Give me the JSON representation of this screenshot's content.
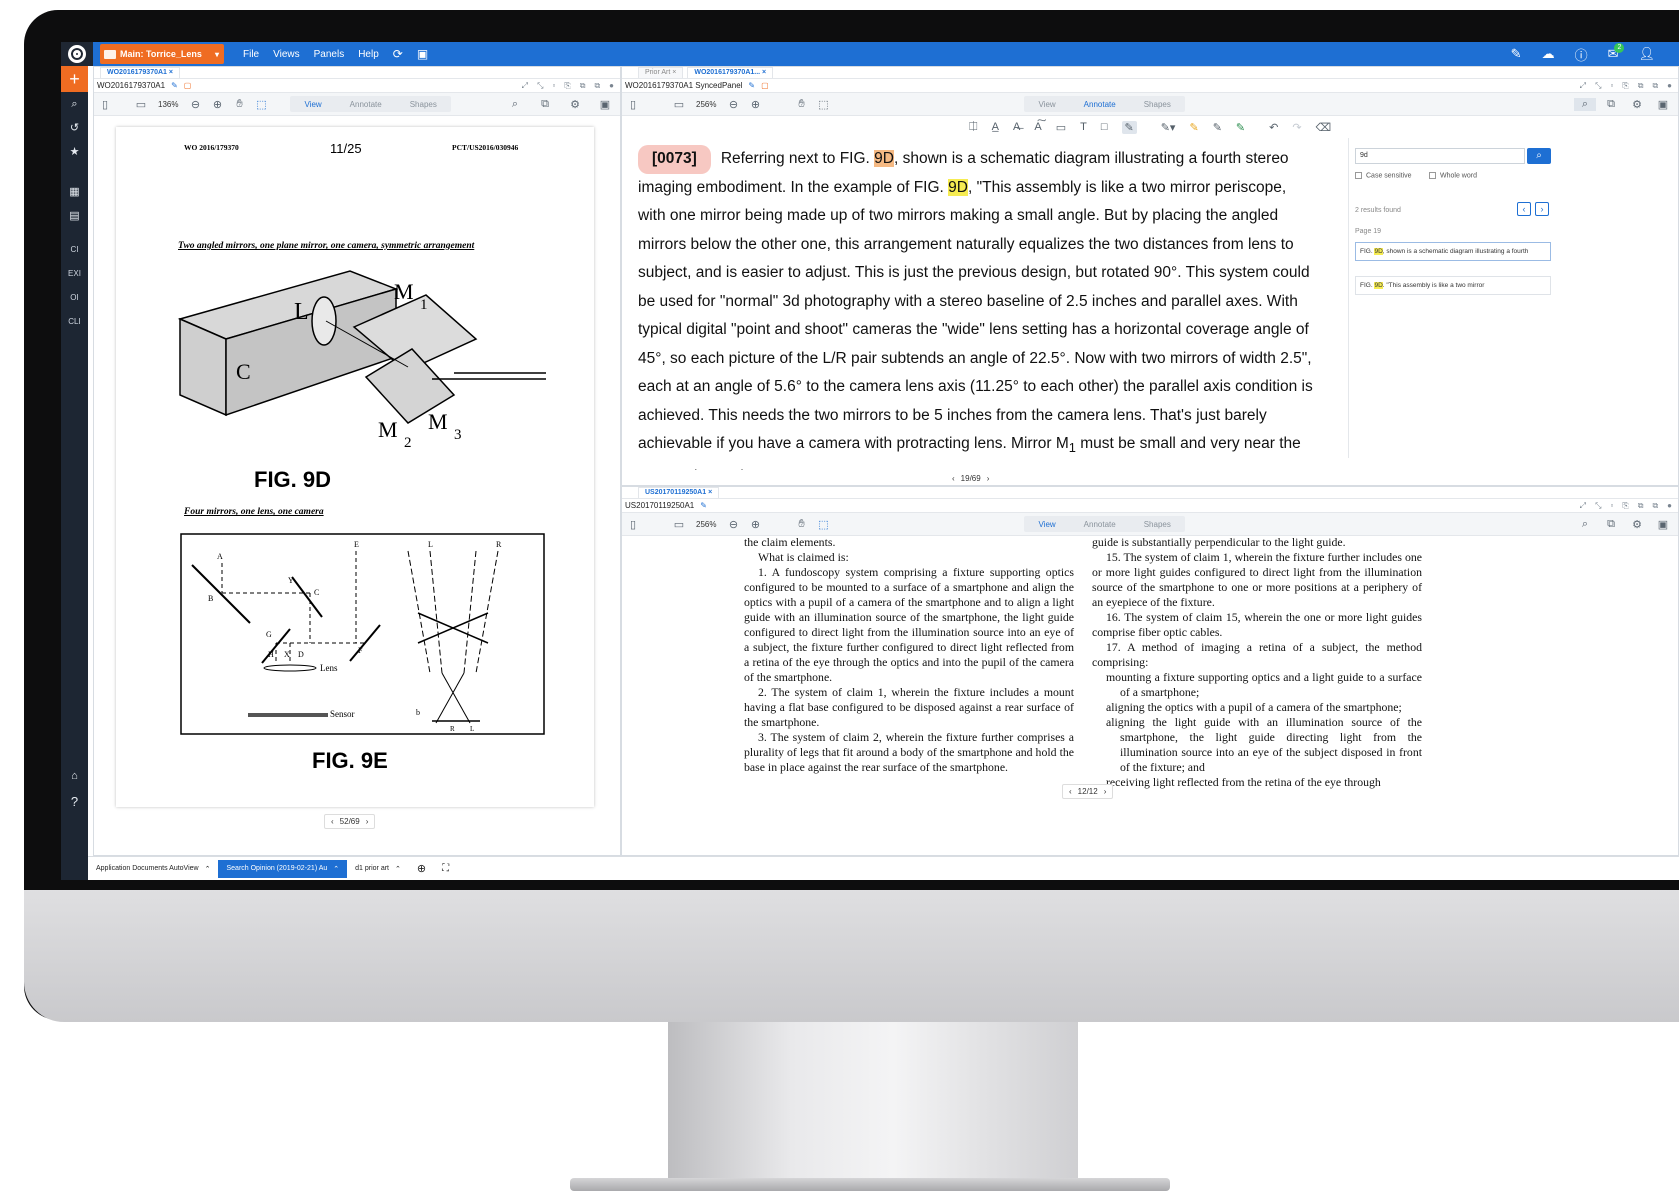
{
  "app": {
    "project": "Main: Torrice_Lens",
    "menus": [
      "File",
      "Views",
      "Panels",
      "Help"
    ]
  },
  "sidenav": {
    "labels": [
      "CI",
      "EXI",
      "OI",
      "CLI"
    ]
  },
  "left_panel": {
    "tab": "WO2016179370A1",
    "doc_title": "WO2016179370A1",
    "zoom": "136%",
    "modes": [
      "View",
      "Annotate",
      "Shapes"
    ],
    "page": {
      "header_left": "WO 2016/179370",
      "header_center": "11/25",
      "header_right": "PCT/US2016/030946",
      "caption1": "Two angled mirrors, one plane mirror, one camera, symmetric arrangement",
      "fig1": "FIG. 9D",
      "caption2": "Four mirrors, one lens, one camera",
      "fig2": "FIG. 9E",
      "sketch_labels": {
        "l": "L",
        "c": "C",
        "m1": "M",
        "m1s": "1",
        "m2": "M",
        "m2s": "2",
        "m3": "M",
        "m3s": "3",
        "a": "A",
        "b": "B",
        "c2": "C",
        "e": "E",
        "f": "F",
        "g": "G",
        "h": "H",
        "x": "X",
        "d": "D",
        "y": "Y",
        "lens": "Lens",
        "sensor": "Sensor",
        "r": "R",
        "lb": "b",
        "l2": "L",
        "r2": "R",
        "l3": "L"
      }
    },
    "pager": "52/69"
  },
  "right_top_panel": {
    "tabs": [
      "Prior Art",
      "WO2016179370A1..."
    ],
    "doc_title": "WO2016179370A1 SyncedPanel",
    "zoom": "256%",
    "modes": [
      "View",
      "Annotate",
      "Shapes"
    ],
    "paragraph": {
      "num": "[0073]",
      "t1": "Referring next to FIG. ",
      "h1": "9D",
      "t2": ", shown is a schematic diagram illustrating a fourth stereo imaging embodiment.  In the example of FIG. ",
      "h2": "9D",
      "t3": ", \"This assembly is like a two mirror periscope, with one mirror being made up of two mirrors making a small angle. But by placing the angled mirrors below the other one, this arrangement naturally equalizes the two distances from lens to subject, and is easier to adjust. This is just the previous design, but rotated 90°. This system could be used for \"normal\" 3d photography with a stereo baseline of 2.5 inches and parallel axes. With typical digital \"point and shoot\" cameras the \"wide\" lens setting has a horizontal coverage angle of 45°, so each picture of the L/R pair subtends an angle of 22.5°. Now with two mirrors of width 2.5\", each at an angle of 5.6° to the camera lens axis (11.25° to each other) the parallel axis condition is achieved. This needs the two mirrors to be 5 inches from the camera lens. That's just barely achievable if you have a camera with protracting lens. Mirror M",
      "t3sub": "1",
      "t4": " must be small and very near the camera lens. The"
    },
    "pager": "19/69",
    "search": {
      "query": "9d",
      "case_label": "Case sensitive",
      "word_label": "Whole word",
      "count": "2 results found",
      "page_label": "Page 19",
      "r1a": "FIG. ",
      "r1h": "9D",
      "r1b": ", shown is a schematic diagram illustrating a fourth",
      "r2a": "FIG. ",
      "r2h": "9D",
      "r2b": ". \"This assembly is like a two mirror"
    }
  },
  "right_bottom_panel": {
    "tab": "US20170119250A1",
    "doc_title": "US20170119250A1",
    "zoom": "256%",
    "modes": [
      "View",
      "Annotate",
      "Shapes"
    ],
    "col1": [
      "the claim elements.",
      "What is claimed is:",
      "1. A fundoscopy system comprising a fixture supporting optics configured to be mounted to a surface of a smartphone and align the optics with a pupil of a camera of the smartphone and to align a light guide with an illumination source of the smartphone, the light guide configured to direct light from the illumination source into an eye of a subject, the fixture further configured to direct light reflected from a retina of the eye through the optics and into the pupil of the camera of the smartphone.",
      "2. The system of claim 1, wherein the fixture includes a mount having a flat base configured to be disposed against a rear surface of the smartphone.",
      "3. The system of claim 2, wherein the fixture further comprises a plurality of legs that fit around a body of the smartphone and hold the base in place against the rear surface of the smartphone."
    ],
    "col2": [
      "guide is substantially perpendicular to the light guide.",
      "15. The system of claim 1, wherein the fixture further includes one or more light guides configured to direct light from the illumination source of the smartphone to one or more positions at a periphery of an eyepiece of the fixture.",
      "16. The system of claim 15, wherein the one or more light guides comprise fiber optic cables.",
      "17. A method of imaging a retina of a subject, the method comprising:",
      "mounting a fixture supporting optics and a light guide to a surface of a smartphone;",
      "aligning the optics with a pupil of a camera of the smartphone;",
      "aligning the light guide with an illumination source of the smartphone, the light guide directing light from the illumination source into an eye of the subject disposed in front of the fixture; and",
      "receiving light reflected from the retina of the eye through"
    ],
    "pager": "12/12"
  },
  "bottom_bar": {
    "items": [
      "Application Documents AutoView",
      "Search Opinion (2019-02-21) Au",
      "d1 prior art"
    ]
  },
  "colors": {
    "accent": "#1e6fd3",
    "brand_orange": "#ef6c22",
    "nav_dark": "#1d2633"
  }
}
